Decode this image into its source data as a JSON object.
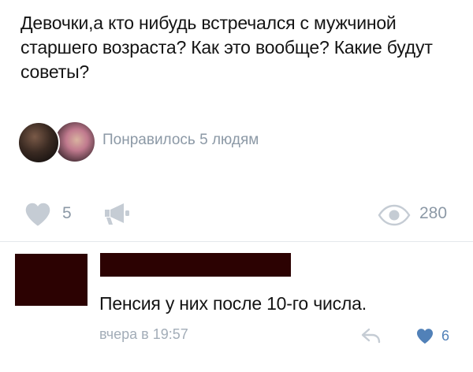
{
  "post": {
    "text": "Девочки,а кто нибудь встречался с мужчиной старшего возраста? Как это вообще? Какие будут советы?",
    "liked_by_label": "Понравилось 5 людям",
    "like_count": "5",
    "views_count": "280"
  },
  "comment": {
    "text": "Пенсия у них после 10-го числа.",
    "date": "вчера в 19:57",
    "like_count": "6"
  },
  "icons": {
    "like": "heart-icon",
    "share": "megaphone-icon",
    "views": "eye-icon",
    "reply": "reply-arrow-icon",
    "comment_like": "heart-icon"
  },
  "colors": {
    "muted_text": "#8c99a6",
    "inactive_icon": "#c5ccd4",
    "accent": "#5181b8",
    "redaction": "#2c0202",
    "date_text": "#a3adb8"
  }
}
